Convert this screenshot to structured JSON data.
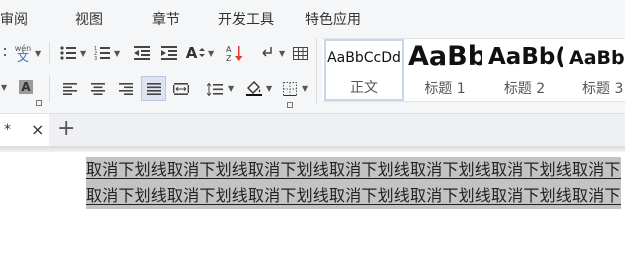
{
  "menu": {
    "tabs": [
      "审阅",
      "视图",
      "章节",
      "开发工具",
      "特色应用"
    ]
  },
  "toolbar": {
    "pinyin_top": "wén",
    "pinyin_bottom": "文",
    "font_shade_label": "A",
    "font_size_label": "A"
  },
  "styles": {
    "items": [
      {
        "sample": "AaBbCcDd",
        "name": "正文"
      },
      {
        "sample": "AaBb",
        "name": "标题 1"
      },
      {
        "sample": "AaBb(",
        "name": "标题 2"
      },
      {
        "sample": "AaBb",
        "name": "标题 3"
      }
    ]
  },
  "tabbar": {
    "doc_tab_label": "*",
    "close_symbol": "×",
    "new_tab_symbol": "+"
  },
  "document": {
    "lines": [
      "取消下划线取消下划线取消下划线取消下划线取消下划线取消下划线取消下划线",
      "取消下划线取消下划线取消下划线取消下划线取消下划线取消下划线取消下划线"
    ]
  },
  "colors": {
    "ribbon_bg": "#f5f6f7",
    "selection": "#c3c3c3",
    "active_button": "#dde3ef",
    "highlight_red": "#e53935"
  }
}
